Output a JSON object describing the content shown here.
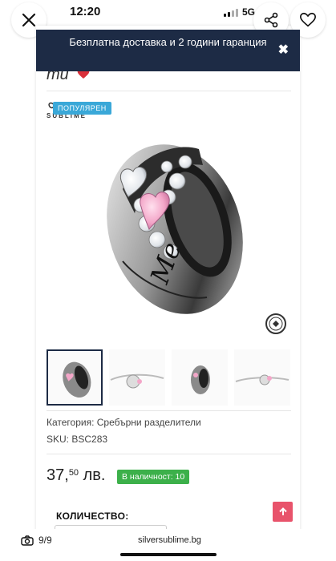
{
  "status_bar": {
    "time": "12:20",
    "network": "5G"
  },
  "viewer": {
    "close_icon": "close-icon",
    "share_icon": "share-icon",
    "favorite_icon": "heart-outline-icon"
  },
  "banner": {
    "text": "Безплатна доставка и 2 години гаранция",
    "close_label": "✖"
  },
  "product": {
    "title_partial": "mu",
    "brand": "SUBLIME",
    "badge": "ПОПУЛЯРЕН",
    "category": "Категория: Сребърни разделители",
    "sku": "SKU: BSC283",
    "price_main": "37,",
    "price_cents": "50",
    "currency": "лв.",
    "stock": "В наличност: 10",
    "quantity_label": "КОЛИЧЕСТВО:",
    "engraving": "Me",
    "accent_color": "#1d2b45",
    "stock_color": "#3cb04a",
    "scroll_color": "#e8536b"
  },
  "browser": {
    "counter": "9/9",
    "url": "silversublime.bg"
  }
}
